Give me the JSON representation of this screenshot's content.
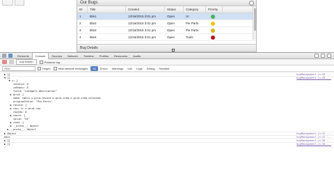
{
  "app": {
    "panel_title": "Our Bugs",
    "columns": [
      "ID",
      "Title",
      "Created",
      "Status",
      "Category",
      "Priority"
    ],
    "rows": [
      {
        "id": "1",
        "title": "title1",
        "created": "12/16/2015 3:01 pm",
        "status": "Open",
        "category": "UI",
        "priority_color": "#4caf50"
      },
      {
        "id": "2",
        "title": "title2",
        "created": "12/16/2015 3:01 pm",
        "status": "Open",
        "category": "Pie Parts",
        "priority_color": "#e8c21a"
      },
      {
        "id": "3",
        "title": "title3",
        "created": "12/16/2015 3:01 pm",
        "status": "Open",
        "category": "Pie Parts",
        "priority_color": "#d8b216"
      },
      {
        "id": "4",
        "title": "title4",
        "created": "12/16/2015 3:01 pm",
        "status": "Open",
        "category": "Tools",
        "priority_color": "#b01a1a"
      }
    ],
    "details_label": "Bug Details"
  },
  "devtools": {
    "tabs": [
      "Elements",
      "Console",
      "Sources",
      "Network",
      "Timeline",
      "Profiles",
      "Resources",
      "Audits"
    ],
    "active_tab": "Console",
    "toolbar": {
      "context": "<top frame>",
      "preserve_log": "Preserve log"
    },
    "filter": {
      "placeholder": "Filter",
      "regex": "Regex",
      "hide_network": "Hide network messages",
      "levels": [
        "All",
        "Errors",
        "Warnings",
        "Info",
        "Logs",
        "Debug",
        "Handled"
      ],
      "active_level": "All"
    },
    "console_lines": [
      {
        "text": "▶ {}",
        "src": "bugManagement.js:28 ..."
      },
      {
        "text": "▼ {}",
        "src": "bugManagement.js:28 ..."
      },
      {
        "text": "   ▼ y: {",
        "src": ""
      },
      {
        "text": "      isValid: 0",
        "src": ""
      },
      {
        "text": "      isEmpty: 0",
        "src": ""
      },
      {
        "text": "      field: \"category.description\"",
        "src": ""
      },
      {
        "text": "    ▶ grid: {",
        "src": ""
      },
      {
        "text": "      node: table.x-grid-record.x-grid-item.x-grid-item-selected",
        "src": ""
      },
      {
        "text": "      originalValue: \"Pie Parts\"",
        "src": ""
      },
      {
        "text": "    ▶ record: {",
        "src": ""
      },
      {
        "text": "    ▶ row: tr.x-grid-row",
        "src": ""
      },
      {
        "text": "      rowIdx: 0",
        "src": ""
      },
      {
        "text": "    ▶ store: {",
        "src": ""
      },
      {
        "text": "      value: \"UI\"",
        "src": ""
      },
      {
        "text": "    ▶ view: {",
        "src": ""
      },
      {
        "text": "    ▶ __proto__: Object",
        "src": ""
      },
      {
        "text": "  ▶ __proto__: Object",
        "src": ""
      },
      {
        "text": "▶ Object",
        "src": "bugManagement.js:41 ..."
      },
      {
        "text": "edit",
        "src": "bugManagement.js:41 ..."
      },
      {
        "text": "▶ {}",
        "src": "bugManagement.js:28 ..."
      },
      {
        "text": "▶ {}",
        "src": "bugManagement.js:28 ..."
      },
      {
        "text": "›",
        "src": ""
      }
    ]
  }
}
